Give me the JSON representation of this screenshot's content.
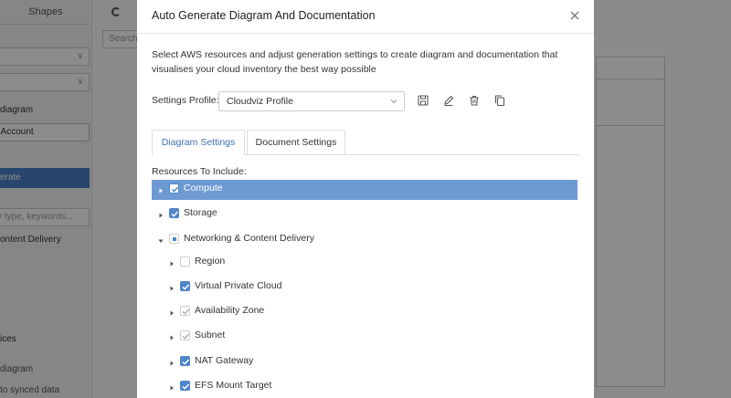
{
  "background": {
    "left_tab": "Shapes",
    "text_diagram": "diagram",
    "text_account": "r Account",
    "btn_generate": "erate",
    "search_placeholder": "y type, keywords...",
    "text_content_delivery": "ontent Delivery",
    "text_ices": "ices",
    "text_diagram2": "diagram",
    "text_synced": "to synced data",
    "top_search": "Search"
  },
  "modal": {
    "title": "Auto Generate Diagram And Documentation",
    "description": "Select AWS resources and adjust generation settings to create diagram and documentation that visualises your cloud inventory the best way possible",
    "profile_label": "Settings Profile:",
    "profile_value": "Cloudviz Profile",
    "tabs": [
      {
        "label": "Diagram Settings",
        "active": true
      },
      {
        "label": "Document Settings",
        "active": false
      }
    ],
    "resources_label": "Resources To Include:",
    "tree": [
      {
        "label": "Compute",
        "level": 0,
        "state": "checked",
        "expanded": false,
        "selected": true
      },
      {
        "label": "Storage",
        "level": 0,
        "state": "checked",
        "expanded": false,
        "selected": false
      },
      {
        "label": "Networking & Content Delivery",
        "level": 0,
        "state": "partial",
        "expanded": true,
        "selected": false
      },
      {
        "label": "Region",
        "level": 1,
        "state": "unchecked",
        "expanded": false,
        "selected": false
      },
      {
        "label": "Virtual Private Cloud",
        "level": 1,
        "state": "checked",
        "expanded": false,
        "selected": false
      },
      {
        "label": "Availability Zone",
        "level": 1,
        "state": "checked-gray",
        "expanded": false,
        "selected": false
      },
      {
        "label": "Subnet",
        "level": 1,
        "state": "checked-gray",
        "expanded": false,
        "selected": false
      },
      {
        "label": "NAT Gateway",
        "level": 1,
        "state": "checked",
        "expanded": false,
        "selected": false
      },
      {
        "label": "EFS Mount Target",
        "level": 1,
        "state": "checked",
        "expanded": false,
        "selected": false
      }
    ]
  },
  "colors": {
    "accent": "#4f86c9",
    "selected_row": "#6e9ad4",
    "active_tab_text": "#3f6fb5",
    "overlay": "rgba(0,0,0,0.45)"
  },
  "icons": {
    "close": "close-icon",
    "save": "save-icon",
    "edit": "pencil-icon",
    "delete": "trash-icon",
    "copy": "copy-icon",
    "dropdown": "chevron-down-icon",
    "caret_right": "caret-right-icon",
    "caret_down": "caret-down-icon"
  }
}
